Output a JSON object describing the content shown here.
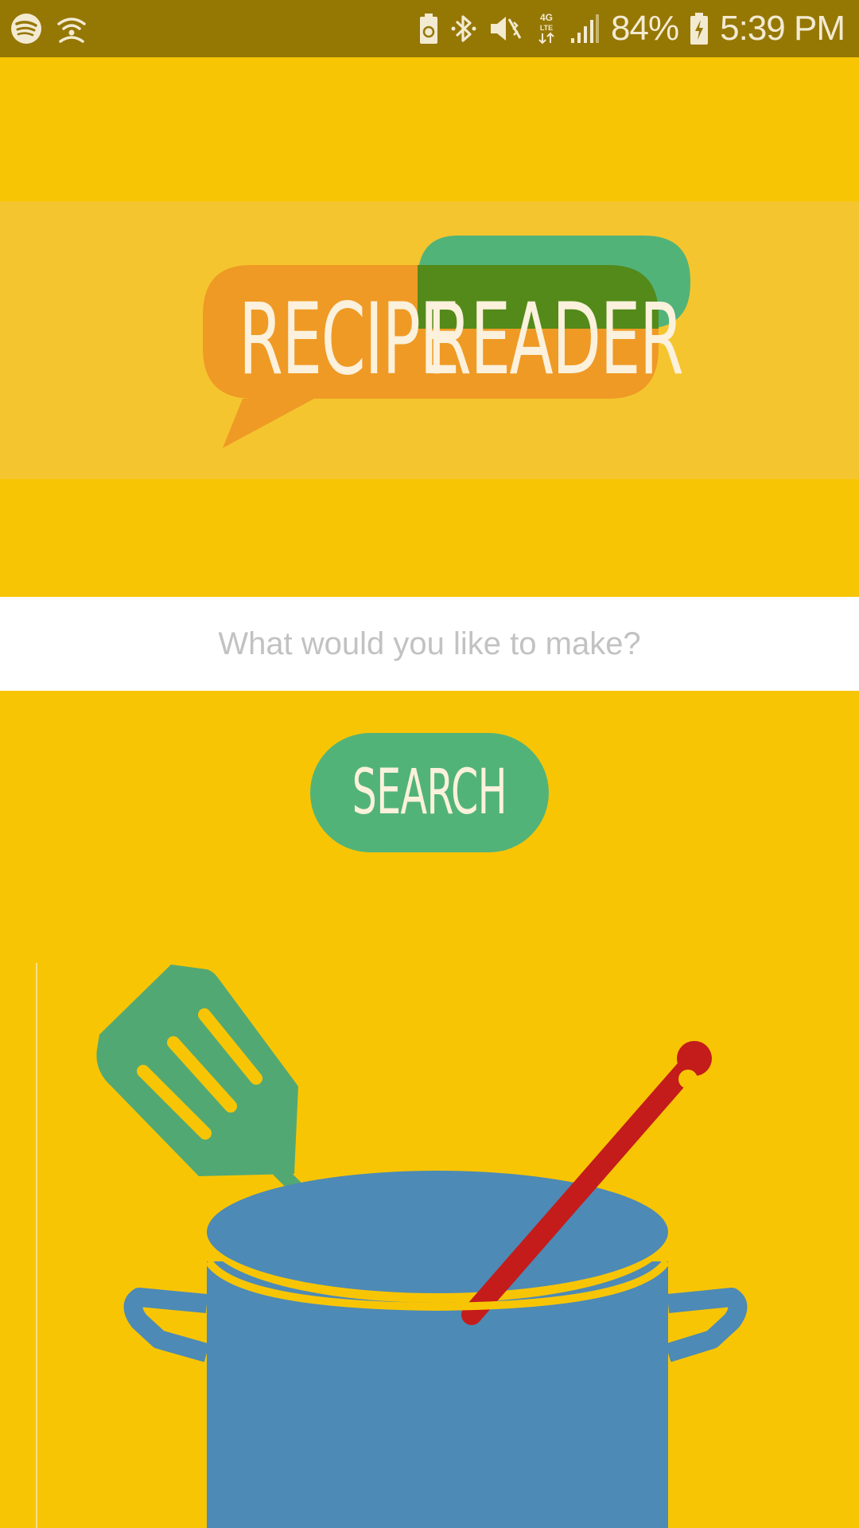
{
  "status_bar": {
    "left_icons": [
      "spotify-icon",
      "wifi-hotspot-icon"
    ],
    "right_icons": [
      "battery-saver-icon",
      "bluetooth-icon",
      "vibrate-icon",
      "lte-icon",
      "signal-icon"
    ],
    "battery_percent": "84%",
    "battery_icon": "battery-charging-icon",
    "time": "5:39 PM"
  },
  "logo": {
    "word1": "RECIPE",
    "word2": "READER",
    "colors": {
      "orange": "#ef9a25",
      "green": "#52b379",
      "dark_green": "#538a1a",
      "text": "#fbf1dc"
    }
  },
  "search": {
    "placeholder": "What would you like to make?",
    "value": "",
    "button_label": "SEARCH"
  },
  "illustration": {
    "icons": [
      "spatula-icon",
      "cooking-pot-icon",
      "spoon-icon"
    ],
    "colors": {
      "pot": "#4d8ab5",
      "spatula": "#52a873",
      "spoon": "#c41c1a",
      "background": "#f8c505"
    }
  },
  "colors": {
    "background": "#f8c505",
    "status_bar": "#957704",
    "button": "#52b379"
  }
}
